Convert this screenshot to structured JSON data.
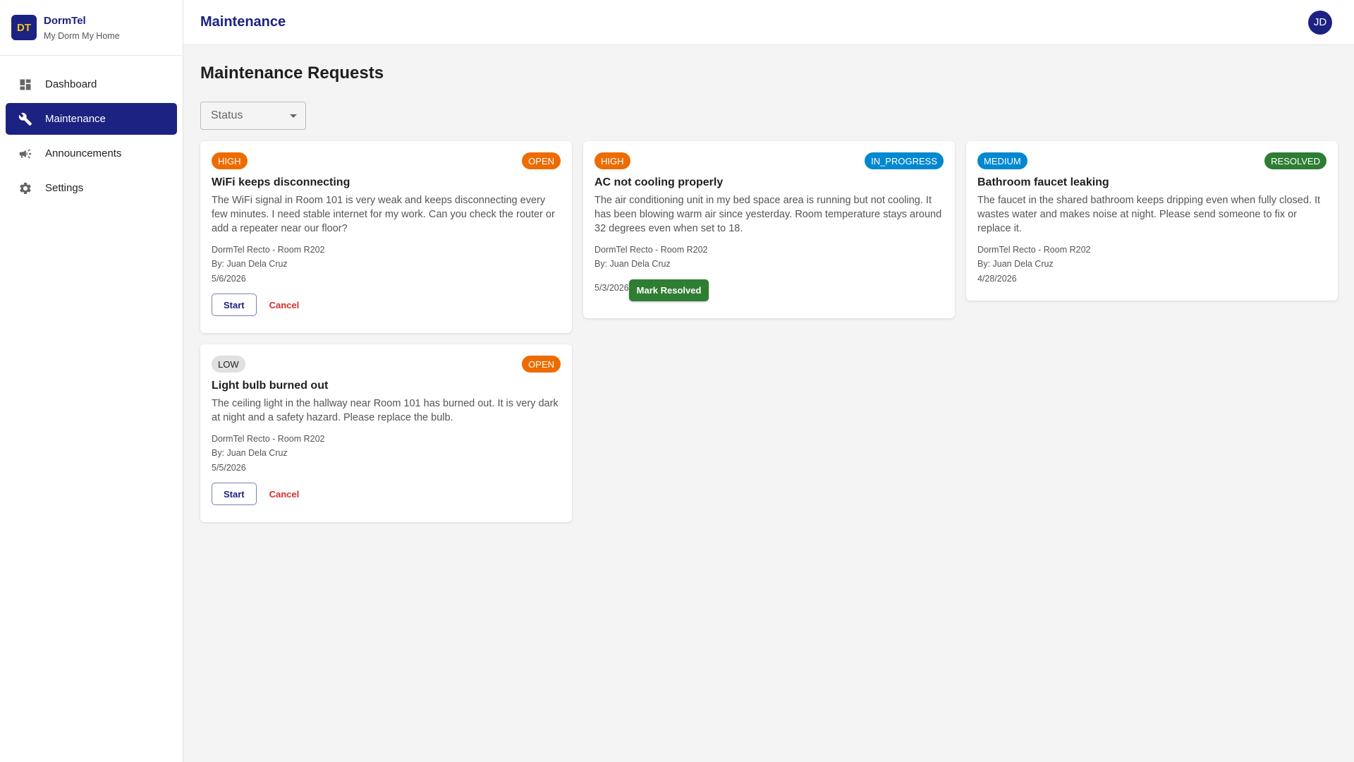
{
  "brand": {
    "logo": "DT",
    "name": "DormTel",
    "tagline": "My Dorm My Home"
  },
  "sidebar": {
    "items": [
      {
        "label": "Dashboard",
        "icon": "dashboard-icon"
      },
      {
        "label": "Maintenance",
        "icon": "wrench-icon",
        "active": true
      },
      {
        "label": "Announcements",
        "icon": "megaphone-icon"
      },
      {
        "label": "Settings",
        "icon": "gear-icon"
      }
    ]
  },
  "header": {
    "title": "Maintenance",
    "avatar": "JD"
  },
  "main": {
    "title": "Maintenance Requests",
    "filter": {
      "placeholder": "Status"
    }
  },
  "cards": [
    {
      "priority": "HIGH",
      "status": "OPEN",
      "title": "WiFi keeps disconnecting",
      "description": "The WiFi signal in Room 101 is very weak and keeps disconnecting every few minutes. I need stable internet for my work. Can you check the router or add a repeater near our floor?",
      "location": "DormTel Recto - Room R202",
      "author": "By: Juan Dela Cruz",
      "date": "5/6/2026",
      "start_label": "Start",
      "cancel_label": "Cancel"
    },
    {
      "priority": "HIGH",
      "status": "IN_PROGRESS",
      "title": "AC not cooling properly",
      "description": "The air conditioning unit in my bed space area is running but not cooling. It has been blowing warm air since yesterday. Room temperature stays around 32 degrees even when set to 18.",
      "location": "DormTel Recto - Room R202",
      "author": "By: Juan Dela Cruz",
      "date": "5/3/2026",
      "resolve_label": "Mark Resolved"
    },
    {
      "priority": "MEDIUM",
      "status": "RESOLVED",
      "title": "Bathroom faucet leaking",
      "description": "The faucet in the shared bathroom keeps dripping even when fully closed. It wastes water and makes noise at night. Please send someone to fix or replace it.",
      "location": "DormTel Recto - Room R202",
      "author": "By: Juan Dela Cruz",
      "date": "4/28/2026"
    },
    {
      "priority": "LOW",
      "status": "OPEN",
      "title": "Light bulb burned out",
      "description": "The ceiling light in the hallway near Room 101 has burned out. It is very dark at night and a safety hazard. Please replace the bulb.",
      "location": "DormTel Recto - Room R202",
      "author": "By: Juan Dela Cruz",
      "date": "5/5/2026",
      "start_label": "Start",
      "cancel_label": "Cancel"
    }
  ],
  "colors": {
    "primary": "#1c2281",
    "high": "#ed6c02",
    "in_progress": "#0288d1",
    "resolved": "#2e7d32",
    "low": "#e0e0e0",
    "cancel": "#d32f2f"
  }
}
